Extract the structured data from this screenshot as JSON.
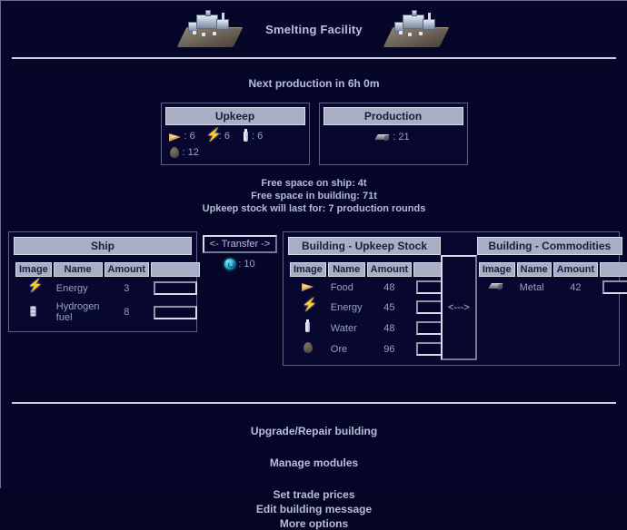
{
  "header": {
    "title": "Smelting Facility",
    "left_icon": "building-sprite-icon",
    "right_icon": "building-sprite-icon"
  },
  "next_production": "Next production in 6h 0m",
  "upkeep": {
    "title": "Upkeep",
    "items": [
      {
        "icon": "food-icon",
        "label": "Food",
        "value": ": 6"
      },
      {
        "icon": "energy-icon",
        "label": "Energy",
        "value": ": 6"
      },
      {
        "icon": "water-icon",
        "label": "Water",
        "value": ": 6"
      },
      {
        "icon": "ore-icon",
        "label": "Ore",
        "value": ": 12"
      }
    ]
  },
  "production": {
    "title": "Production",
    "items": [
      {
        "icon": "metal-icon",
        "label": "Metal",
        "value": ": 21"
      }
    ]
  },
  "space_info": {
    "line1": "Free space on ship: 4t",
    "line2": "Free space in building: 71t",
    "line3": "Upkeep stock will last for: 7 production rounds"
  },
  "ship_table": {
    "title": "Ship",
    "columns": [
      "Image",
      "Name",
      "Amount",
      ""
    ],
    "rows": [
      {
        "icon": "energy-icon",
        "name": "Energy",
        "amount": "3",
        "input_value": ""
      },
      {
        "icon": "hydrogen-icon",
        "name": "Hydrogen fuel",
        "amount": "8",
        "input_value": ""
      }
    ]
  },
  "transfer": {
    "button_label": "<- Transfer ->",
    "credit_icon": "credit-icon",
    "credit_value": ": 10"
  },
  "building_upkeep_table": {
    "title": "Building - Upkeep Stock",
    "columns": [
      "Image",
      "Name",
      "Amount",
      ""
    ],
    "rows": [
      {
        "icon": "food-icon",
        "name": "Food",
        "amount": "48",
        "input_value": ""
      },
      {
        "icon": "energy-icon",
        "name": "Energy",
        "amount": "45",
        "input_value": ""
      },
      {
        "icon": "water-icon",
        "name": "Water",
        "amount": "48",
        "input_value": ""
      },
      {
        "icon": "ore-icon",
        "name": "Ore",
        "amount": "96",
        "input_value": ""
      }
    ]
  },
  "swap_button": {
    "label": "<--->"
  },
  "building_commodities_table": {
    "title": "Building - Commodities",
    "columns": [
      "Image",
      "Name",
      "Amount",
      ""
    ],
    "rows": [
      {
        "icon": "metal-icon",
        "name": "Metal",
        "amount": "42",
        "input_value": ""
      }
    ]
  },
  "footer_links": [
    {
      "label": "Upgrade/Repair building"
    },
    {
      "label": "Manage modules"
    },
    {
      "label": "Set trade prices"
    },
    {
      "label": "Edit building message"
    },
    {
      "label": "More options"
    }
  ],
  "colors": {
    "background": "#060628",
    "panel_header": "#a8aec4",
    "text": "#b6bfd9",
    "border": "#5b6287",
    "rule": "#c9cee0"
  }
}
